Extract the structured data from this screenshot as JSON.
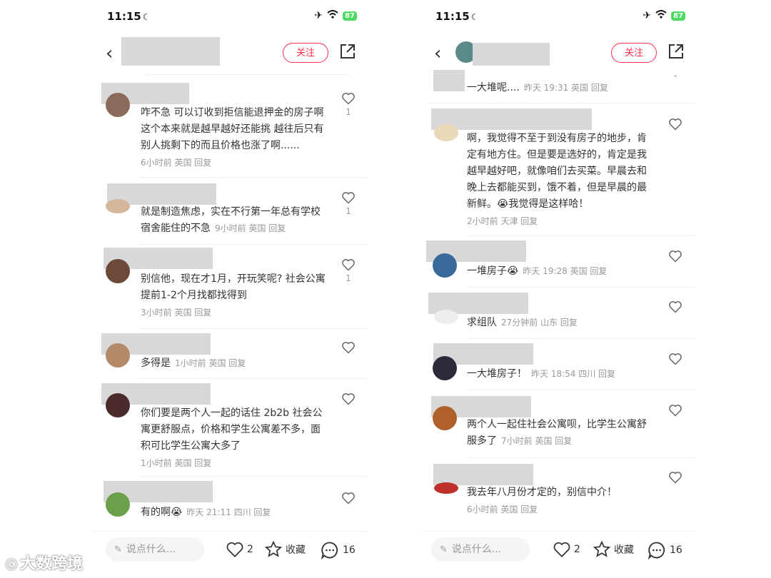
{
  "status": {
    "time": "11:15",
    "battery": "87"
  },
  "header": {
    "follow_label": "关注"
  },
  "left": {
    "comments": [
      {
        "text": "咋不急 可以订收到拒信能退押金的房子啊 这个本来就是越早越好还能挑 越往后只有别人挑剩下的而且价格也涨了啊......",
        "meta": "6小时前 英国 回复",
        "likes": "1"
      },
      {
        "text": "就是制造焦虑，实在不行第一年总有学校宿舍能住的不急",
        "meta": "9小时前 英国 回复",
        "likes": "1"
      },
      {
        "text": "别信他，现在才1月，开玩笑呢? 社会公寓提前1-2个月找都找得到",
        "meta": "3小时前 英国 回复",
        "likes": "1"
      },
      {
        "text": "多得是",
        "meta": "1小时前 英国 回复",
        "likes": ""
      },
      {
        "text": "你们要是两个人一起的话住 2b2b 社会公寓更舒服点，价格和学生公寓差不多，面积可比学生公寓大多了",
        "meta": "1小时前 英国 回复",
        "likes": ""
      },
      {
        "text": "有的啊😭",
        "meta": "昨天 21:11 四川 回复",
        "likes": ""
      }
    ]
  },
  "right": {
    "comments": [
      {
        "text": "一大堆呢....",
        "meta": "昨天 19:31 英国 回复"
      },
      {
        "text": "啊，我觉得不至于到没有房子的地步，肯定有地方住。但是要是选好的，肯定是我越早越好吧，就像咱们去买菜。早晨去和晚上去都能买到，饿不着，但是早晨的最新鲜。😭我觉得是这样哈！",
        "meta": "2小时前 天津 回复"
      },
      {
        "text": "一堆房子😭",
        "meta": "昨天 19:28 英国 回复"
      },
      {
        "text": "求组队",
        "meta": "27分钟前 山东 回复"
      },
      {
        "text": "一大堆房子！",
        "meta": "昨天 18:54 四川 回复"
      },
      {
        "text": "两个人一起住社会公寓呗，比学生公寓舒服多了",
        "meta": "7小时前 英国 回复"
      },
      {
        "text": "我去年八月份才定的，别信中介！",
        "meta": "6小时前 英国 回复"
      }
    ]
  },
  "bottom": {
    "placeholder": "说点什么...",
    "likes": "2",
    "collect_label": "收藏",
    "comments": "16"
  },
  "watermark": "大数跨境"
}
